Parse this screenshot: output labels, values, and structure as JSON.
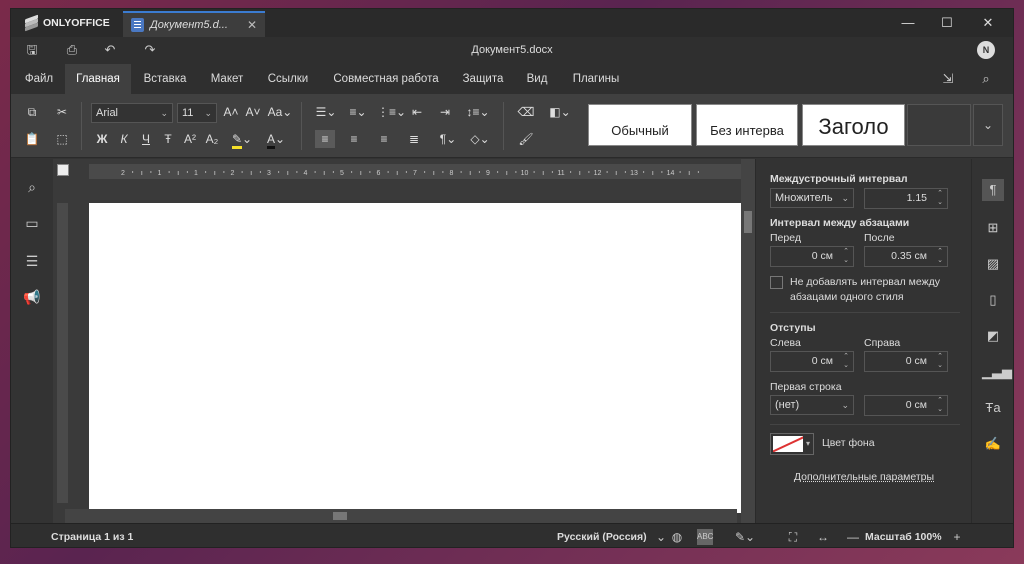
{
  "app": {
    "brand": "ONLYOFFICE",
    "tab_title": "Документ5.d...",
    "doc_title": "Документ5.docx",
    "avatar": "N"
  },
  "tabs": [
    "Файл",
    "Главная",
    "Вставка",
    "Макет",
    "Ссылки",
    "Совместная работа",
    "Защита",
    "Вид",
    "Плагины"
  ],
  "toolbar": {
    "font_name": "Arial",
    "font_size": "11",
    "bold": "Ж",
    "italic": "К",
    "underline": "Ч",
    "strike": "Ŧ",
    "styles": [
      "Обычный",
      "Без интерва",
      "Заголо"
    ]
  },
  "ruler": {
    "numbers": [
      "2",
      "1",
      "1",
      "2",
      "3",
      "4",
      "5",
      "6",
      "7",
      "8",
      "9",
      "10",
      "11",
      "12",
      "13",
      "14"
    ]
  },
  "panel": {
    "line_spacing_label": "Междустрочный интервал",
    "line_spacing_mode": "Множитель",
    "line_spacing_value": "1.15",
    "para_spacing_label": "Интервал между абзацами",
    "before_label": "Перед",
    "before_value": "0 см",
    "after_label": "После",
    "after_value": "0.35 см",
    "no_interval_text_1": "Не добавлять интервал между",
    "no_interval_text_2": "абзацами одного стиля",
    "indents_label": "Отступы",
    "left_label": "Слева",
    "left_value": "0 см",
    "right_label": "Справа",
    "right_value": "0 см",
    "first_line_label": "Первая строка",
    "first_line_mode": "(нет)",
    "first_line_value": "0 см",
    "bg_color_label": "Цвет фона",
    "advanced_link": "Дополнительные параметры"
  },
  "status": {
    "page_info": "Страница 1 из 1",
    "language": "Русский (Россия)",
    "zoom": "Масштаб 100%"
  }
}
